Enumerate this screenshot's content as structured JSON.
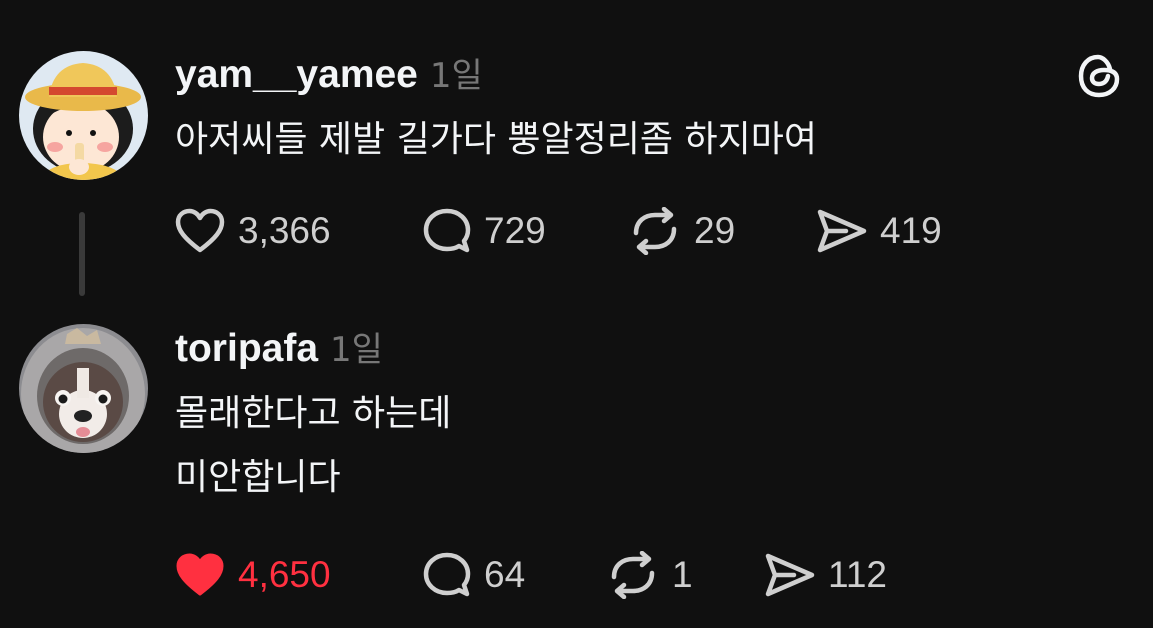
{
  "app": {
    "logo_icon": "threads-logo-icon",
    "accent_like_color": "#ff3040",
    "background_color": "#101010"
  },
  "posts": [
    {
      "username": "yam__yamee",
      "time": "1일",
      "avatar_icon": "cartoon-girl-avatar",
      "text_lines": [
        "아저씨들 제발 길가다 뿡알정리좀 하지마여"
      ],
      "liked": false,
      "likes": "3,366",
      "replies": "729",
      "reposts": "29",
      "shares": "419"
    },
    {
      "username": "toripafa",
      "time": "1일",
      "avatar_icon": "dog-in-hood-avatar",
      "text_lines": [
        "몰래한다고 하는데",
        "미안합니다"
      ],
      "liked": true,
      "likes": "4,650",
      "replies": "64",
      "reposts": "1",
      "shares": "112"
    }
  ]
}
